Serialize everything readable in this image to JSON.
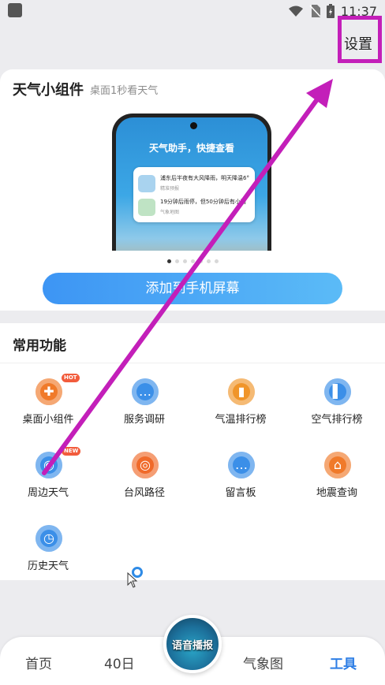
{
  "status_bar": {
    "time": "11:37"
  },
  "header": {
    "settings_label": "设置"
  },
  "widget_card": {
    "title": "天气小组件",
    "subtitle": "桌面1秒看天气",
    "preview": {
      "headline": "天气助手，快捷查看",
      "rows": [
        {
          "text": "浦东后半夜有大风降雨，明天降温6°",
          "sub": "精准预报"
        },
        {
          "text": "19分钟后雨停，但50分钟后有小雨",
          "sub": "气象地图"
        }
      ]
    },
    "pager": {
      "count": 7,
      "active_index": 0
    },
    "add_button_label": "添加到手机屏幕"
  },
  "features": {
    "title": "常用功能",
    "items": [
      {
        "label": "桌面小组件",
        "icon": "puzzle-icon",
        "badge": "HOT",
        "color": "#f07a2a"
      },
      {
        "label": "服务调研",
        "icon": "message-icon",
        "badge": "",
        "color": "#3b8fe8"
      },
      {
        "label": "气温排行榜",
        "icon": "thermometer-icon",
        "badge": "",
        "color": "#f0952a"
      },
      {
        "label": "空气排行榜",
        "icon": "bar-chart-icon",
        "badge": "",
        "color": "#3b8fe8"
      },
      {
        "label": "周边天气",
        "icon": "location-weather-icon",
        "badge": "NEW",
        "color": "#3b8fe8"
      },
      {
        "label": "台风路径",
        "icon": "typhoon-icon",
        "badge": "",
        "color": "#f06a2a"
      },
      {
        "label": "留言板",
        "icon": "chat-icon",
        "badge": "",
        "color": "#3b8fe8"
      },
      {
        "label": "地震查询",
        "icon": "earthquake-icon",
        "badge": "",
        "color": "#f07a2a"
      },
      {
        "label": "历史天气",
        "icon": "calendar-clock-icon",
        "badge": "",
        "color": "#3b8fe8"
      }
    ]
  },
  "bottom_nav": {
    "items": [
      {
        "label": "首页",
        "active": false
      },
      {
        "label": "40日",
        "active": false
      },
      {
        "label": "气象图",
        "active": false
      },
      {
        "label": "工具",
        "active": true
      }
    ],
    "voice_label": "语音播报"
  },
  "colors": {
    "accent": "#2f7fe6",
    "annotation": "#c31fb9"
  }
}
